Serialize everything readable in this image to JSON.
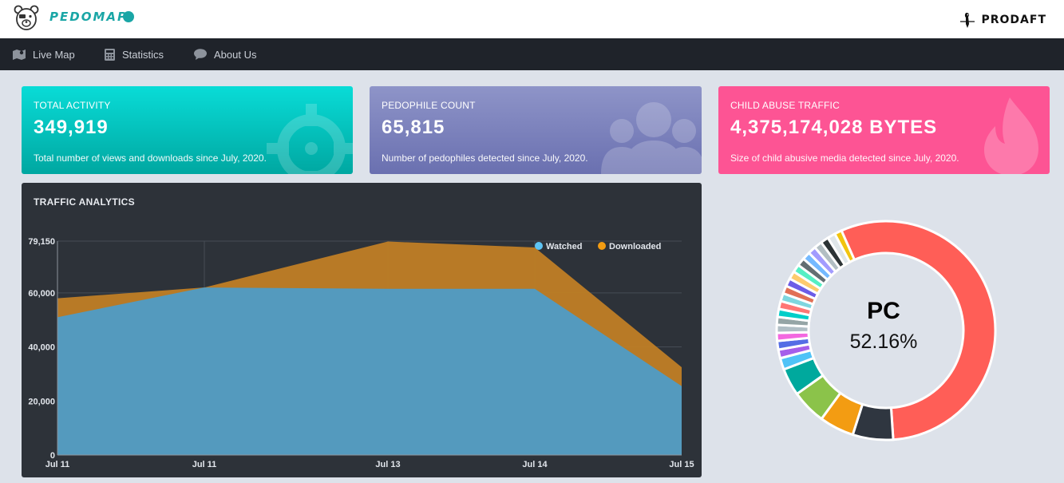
{
  "header": {
    "logo_text": "PEDOMAP",
    "brand_text": "PRODAFT"
  },
  "nav": [
    {
      "label": "Live Map",
      "icon": "map-icon"
    },
    {
      "label": "Statistics",
      "icon": "calculator-icon"
    },
    {
      "label": "About Us",
      "icon": "comment-icon"
    }
  ],
  "cards": [
    {
      "title": "TOTAL ACTIVITY",
      "value": "349,919",
      "desc": "Total number of views and downloads since July, 2020.",
      "icon": "crosshair-icon",
      "color": "#09dcd7"
    },
    {
      "title": "PEDOPHILE COUNT",
      "value": "65,815",
      "desc": "Number of pedophiles detected since July, 2020.",
      "icon": "users-icon",
      "color": "#8e94c8"
    },
    {
      "title": "CHILD ABUSE TRAFFIC",
      "value": "4,375,174,028 BYTES",
      "desc": "Size of child abusive media detected since July, 2020.",
      "icon": "fire-icon",
      "color": "#fd5494"
    }
  ],
  "traffic": {
    "title": "TRAFFIC ANALYTICS",
    "legend": [
      {
        "name": "Watched",
        "color": "#5ec4f3"
      },
      {
        "name": "Downloaded",
        "color": "#f39c12"
      }
    ]
  },
  "donut": {
    "label": "PC",
    "percent": "52.16%"
  },
  "chart_data": [
    {
      "type": "area",
      "title": "TRAFFIC ANALYTICS",
      "x": [
        "Jul 11",
        "Jul 11",
        "Jul 13",
        "Jul 14",
        "Jul 15"
      ],
      "x_numeric": [
        0,
        0.8,
        1.8,
        2.6,
        3.4
      ],
      "ytick_labels": [
        "0",
        "20,000",
        "40,000",
        "60,000",
        "79,150"
      ],
      "ylim": [
        0,
        79150
      ],
      "series": [
        {
          "name": "Watched",
          "points": [
            [
              0,
              51000
            ],
            [
              0.8,
              62000
            ],
            [
              1.8,
              61500
            ],
            [
              2.6,
              61500
            ],
            [
              3.4,
              25500
            ]
          ]
        },
        {
          "name": "Downloaded",
          "points": [
            [
              0,
              58000
            ],
            [
              0.8,
              62000
            ],
            [
              1.8,
              79000
            ],
            [
              2.6,
              76800
            ],
            [
              3.4,
              32500
            ]
          ]
        }
      ],
      "grid": true,
      "legend_position": "top-right"
    },
    {
      "type": "pie",
      "slices": [
        {
          "label": "PC",
          "value": 52.16,
          "color": "#ff5e57"
        },
        {
          "value": 5.6,
          "color": "#2f3640"
        },
        {
          "value": 4.8,
          "color": "#f39c12"
        },
        {
          "value": 4.8,
          "color": "#8bc34a"
        },
        {
          "value": 3.8,
          "color": "#00a99d"
        },
        {
          "value": 1.6,
          "color": "#4fc3f7"
        },
        {
          "value": 1.2,
          "color": "#a55eea"
        },
        {
          "value": 1.2,
          "color": "#546de5"
        },
        {
          "value": 1.1,
          "color": "#f368e0"
        },
        {
          "value": 1.1,
          "color": "#b0bec5"
        },
        {
          "value": 1.1,
          "color": "#95a5a6"
        },
        {
          "value": 1.1,
          "color": "#00cec9"
        },
        {
          "value": 1.1,
          "color": "#ff7675"
        },
        {
          "value": 1.1,
          "color": "#7ed6df"
        },
        {
          "value": 1.1,
          "color": "#e17055"
        },
        {
          "value": 1.1,
          "color": "#6c5ce7"
        },
        {
          "value": 1.1,
          "color": "#fdcb6e"
        },
        {
          "value": 1.1,
          "color": "#55efc4"
        },
        {
          "value": 1.1,
          "color": "#636e72"
        },
        {
          "value": 1.1,
          "color": "#74b9ff"
        },
        {
          "value": 1.1,
          "color": "#a29bfe"
        },
        {
          "value": 1.1,
          "color": "#b2bec3"
        },
        {
          "value": 1.1,
          "color": "#2d3436"
        },
        {
          "value": 1.1,
          "color": "#dfe6e9"
        },
        {
          "value": 1.0,
          "color": "#f1c40f"
        }
      ]
    }
  ]
}
